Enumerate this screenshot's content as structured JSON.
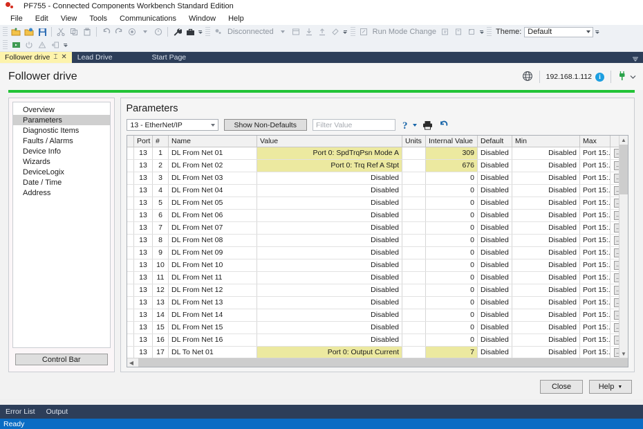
{
  "window": {
    "title": "PF755 - Connected Components Workbench Standard Edition",
    "logo_icon": "rockwell-dots-icon"
  },
  "menubar": {
    "items": [
      "File",
      "Edit",
      "View",
      "Tools",
      "Communications",
      "Window",
      "Help"
    ]
  },
  "toolbar": {
    "row1": [
      {
        "icon": "open-folder-icon"
      },
      {
        "icon": "open-project-icon"
      },
      {
        "icon": "save-icon"
      },
      {
        "icon": "cut-icon"
      },
      {
        "icon": "copy-icon"
      },
      {
        "icon": "paste-icon"
      },
      {
        "icon": "undo-icon"
      },
      {
        "icon": "redo-icon"
      },
      {
        "icon": "build-icon"
      },
      {
        "icon": "build-dropdown-icon"
      },
      {
        "icon": "discovery-icon"
      },
      {
        "icon": "wrench-icon"
      },
      {
        "icon": "toolbox-icon"
      }
    ],
    "connection_status": "Disconnected",
    "connection_icon": "connection-dots-icon",
    "row1_right": [
      {
        "icon": "browse-icon"
      },
      {
        "icon": "download-icon"
      },
      {
        "icon": "upload-icon"
      },
      {
        "icon": "diagnose-icon"
      }
    ],
    "run_mode_label": "Run Mode Change",
    "run_mode_icon": "run-mode-icon",
    "after_run_icons": [
      {
        "icon": "secure-icon"
      },
      {
        "icon": "copy-device-icon"
      },
      {
        "icon": "reset-icon"
      }
    ],
    "theme_label": "Theme:",
    "theme_value": "Default",
    "row2": [
      {
        "icon": "device-toolbar-icon"
      },
      {
        "icon": "power-icon"
      },
      {
        "icon": "warning-icon"
      },
      {
        "icon": "export-icon"
      }
    ]
  },
  "tabs": [
    {
      "label": "Follower drive",
      "active": true,
      "pin_icon": "pin-icon",
      "close_icon": "close-icon"
    },
    {
      "label": "Lead Drive",
      "active": false
    },
    {
      "label": "Start Page",
      "active": false
    }
  ],
  "tabstrip": {
    "overflow_icon": "tab-overflow-caret-icon"
  },
  "document": {
    "title": "Follower drive",
    "globe_icon": "globe-icon",
    "ip_address": "192.168.1.112",
    "info_icon": "info-icon",
    "info_glyph": "i",
    "plug_icon": "plug-connected-icon",
    "plug_caret_icon": "chevron-down-icon"
  },
  "nav": {
    "items": [
      {
        "label": "Overview",
        "selected": false
      },
      {
        "label": "Parameters",
        "selected": true
      },
      {
        "label": "Diagnostic Items",
        "selected": false
      },
      {
        "label": "Faults / Alarms",
        "selected": false
      },
      {
        "label": "Device Info",
        "selected": false
      },
      {
        "label": "Wizards",
        "selected": false
      },
      {
        "label": "DeviceLogix",
        "selected": false
      },
      {
        "label": "Date / Time",
        "selected": false
      },
      {
        "label": "Address",
        "selected": false
      }
    ],
    "control_bar_label": "Control Bar"
  },
  "parameters": {
    "heading": "Parameters",
    "port_select_value": "13 - EtherNet/IP",
    "show_non_defaults_label": "Show Non-Defaults",
    "filter_placeholder": "Filter Value",
    "filter_value": "",
    "tools": [
      {
        "icon": "help-question-icon",
        "has_caret": true
      },
      {
        "icon": "print-icon",
        "has_caret": false
      },
      {
        "icon": "refresh-undo-icon",
        "has_caret": false
      }
    ],
    "columns": [
      "Port",
      "#",
      "Name",
      "Value",
      "Units",
      "Internal Value",
      "Default",
      "Min",
      "Max",
      ""
    ],
    "rows": [
      {
        "port": "13",
        "num": "1",
        "name": "DL From Net 01",
        "value": "Port 0: SpdTrqPsn Mode A",
        "units": "",
        "internal": "309",
        "default": "Disabled",
        "min": "Disabled",
        "max": "Port 15:...",
        "highlight": true,
        "btn": "..."
      },
      {
        "port": "13",
        "num": "2",
        "name": "DL From Net 02",
        "value": "Port 0: Trq Ref A Stpt",
        "units": "",
        "internal": "676",
        "default": "Disabled",
        "min": "Disabled",
        "max": "Port 15:...",
        "highlight": true,
        "btn": "..."
      },
      {
        "port": "13",
        "num": "3",
        "name": "DL From Net 03",
        "value": "Disabled",
        "units": "",
        "internal": "0",
        "default": "Disabled",
        "min": "Disabled",
        "max": "Port 15:...",
        "highlight": false,
        "btn": "..."
      },
      {
        "port": "13",
        "num": "4",
        "name": "DL From Net 04",
        "value": "Disabled",
        "units": "",
        "internal": "0",
        "default": "Disabled",
        "min": "Disabled",
        "max": "Port 15:...",
        "highlight": false,
        "btn": "..."
      },
      {
        "port": "13",
        "num": "5",
        "name": "DL From Net 05",
        "value": "Disabled",
        "units": "",
        "internal": "0",
        "default": "Disabled",
        "min": "Disabled",
        "max": "Port 15:...",
        "highlight": false,
        "btn": "..."
      },
      {
        "port": "13",
        "num": "6",
        "name": "DL From Net 06",
        "value": "Disabled",
        "units": "",
        "internal": "0",
        "default": "Disabled",
        "min": "Disabled",
        "max": "Port 15:...",
        "highlight": false,
        "btn": "..."
      },
      {
        "port": "13",
        "num": "7",
        "name": "DL From Net 07",
        "value": "Disabled",
        "units": "",
        "internal": "0",
        "default": "Disabled",
        "min": "Disabled",
        "max": "Port 15:...",
        "highlight": false,
        "btn": "..."
      },
      {
        "port": "13",
        "num": "8",
        "name": "DL From Net 08",
        "value": "Disabled",
        "units": "",
        "internal": "0",
        "default": "Disabled",
        "min": "Disabled",
        "max": "Port 15:...",
        "highlight": false,
        "btn": "..."
      },
      {
        "port": "13",
        "num": "9",
        "name": "DL From Net 09",
        "value": "Disabled",
        "units": "",
        "internal": "0",
        "default": "Disabled",
        "min": "Disabled",
        "max": "Port 15:...",
        "highlight": false,
        "btn": "..."
      },
      {
        "port": "13",
        "num": "10",
        "name": "DL From Net 10",
        "value": "Disabled",
        "units": "",
        "internal": "0",
        "default": "Disabled",
        "min": "Disabled",
        "max": "Port 15:...",
        "highlight": false,
        "btn": "..."
      },
      {
        "port": "13",
        "num": "11",
        "name": "DL From Net 11",
        "value": "Disabled",
        "units": "",
        "internal": "0",
        "default": "Disabled",
        "min": "Disabled",
        "max": "Port 15:...",
        "highlight": false,
        "btn": "..."
      },
      {
        "port": "13",
        "num": "12",
        "name": "DL From Net 12",
        "value": "Disabled",
        "units": "",
        "internal": "0",
        "default": "Disabled",
        "min": "Disabled",
        "max": "Port 15:...",
        "highlight": false,
        "btn": "..."
      },
      {
        "port": "13",
        "num": "13",
        "name": "DL From Net 13",
        "value": "Disabled",
        "units": "",
        "internal": "0",
        "default": "Disabled",
        "min": "Disabled",
        "max": "Port 15:...",
        "highlight": false,
        "btn": "..."
      },
      {
        "port": "13",
        "num": "14",
        "name": "DL From Net 14",
        "value": "Disabled",
        "units": "",
        "internal": "0",
        "default": "Disabled",
        "min": "Disabled",
        "max": "Port 15:...",
        "highlight": false,
        "btn": "..."
      },
      {
        "port": "13",
        "num": "15",
        "name": "DL From Net 15",
        "value": "Disabled",
        "units": "",
        "internal": "0",
        "default": "Disabled",
        "min": "Disabled",
        "max": "Port 15:...",
        "highlight": false,
        "btn": "..."
      },
      {
        "port": "13",
        "num": "16",
        "name": "DL From Net 16",
        "value": "Disabled",
        "units": "",
        "internal": "0",
        "default": "Disabled",
        "min": "Disabled",
        "max": "Port 15:...",
        "highlight": false,
        "btn": "..."
      },
      {
        "port": "13",
        "num": "17",
        "name": "DL To Net 01",
        "value": "Port 0: Output Current",
        "units": "",
        "internal": "7",
        "default": "Disabled",
        "min": "Disabled",
        "max": "Port 15:...",
        "highlight": true,
        "btn": "..."
      }
    ]
  },
  "footer": {
    "close_label": "Close",
    "help_label": "Help",
    "help_caret": "▼"
  },
  "bottom_panels": {
    "tabs": [
      "Error List",
      "Output"
    ]
  },
  "statusbar": {
    "text": "Ready"
  },
  "colors": {
    "accent_blue": "#0a6cc4",
    "tab_active_yellow": "#fdf3ac",
    "highlight_yellow": "#ece9a0",
    "green_rule": "#22c336",
    "dark_navy": "#2d3e59"
  }
}
